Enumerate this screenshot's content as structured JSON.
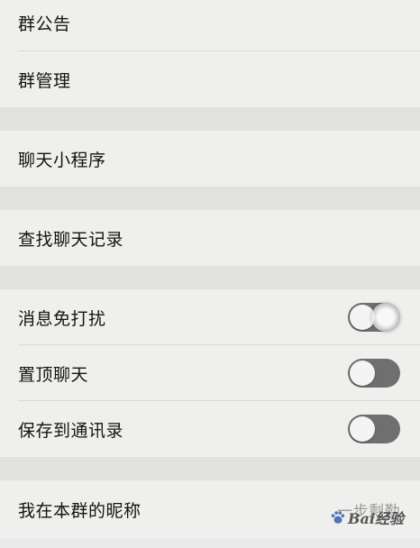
{
  "rows": {
    "announcement": {
      "label": "群公告"
    },
    "management": {
      "label": "群管理"
    },
    "mini_programs": {
      "label": "聊天小程序"
    },
    "search_history": {
      "label": "查找聊天记录"
    },
    "do_not_disturb": {
      "label": "消息免打扰",
      "enabled": false
    },
    "pin_chat": {
      "label": "置顶聊天",
      "enabled": false
    },
    "save_to_contacts": {
      "label": "保存到通讯录",
      "enabled": false
    },
    "my_nickname": {
      "label": "我在本群的昵称",
      "value": "一步剩勤"
    }
  },
  "watermark": {
    "text": "Bai经验"
  },
  "colors": {
    "background": "#efefed",
    "separator": "#e1e1df",
    "switch_off": "#6f6f6f"
  }
}
